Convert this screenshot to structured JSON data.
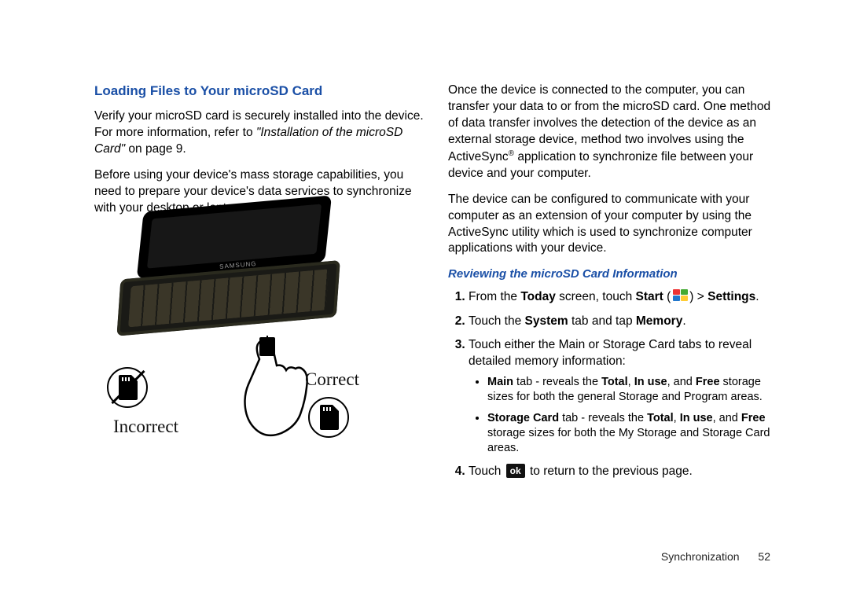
{
  "left": {
    "heading": "Loading Files to Your microSD Card",
    "para1_a": "Verify your microSD card is securely installed into the device. For more information, refer to ",
    "para1_ref": "\"Installation of the microSD Card\"",
    "para1_b": " on page 9.",
    "para2": "Before using your device's mass storage capabilities, you need to prepare your device's data services to synchronize with your desktop or laptop computer.",
    "illustration": {
      "brand": "SAMSUNG",
      "label_incorrect": "Incorrect",
      "label_correct": "Correct"
    }
  },
  "right": {
    "para1": "Once the device is connected to the computer, you can transfer your data to or from the microSD card. One method of data transfer involves the detection of the device as an external storage device, method two involves using the ActiveSync",
    "para1_sup": "®",
    "para1_b": " application to synchronize file between your device and your computer.",
    "para2": "The device can be configured to communicate with your computer as an extension of your computer by using the ActiveSync utility which is used to synchronize computer applications with your device.",
    "subhead": "Reviewing the microSD Card Information",
    "step1_a": "From the ",
    "step1_b": "Today",
    "step1_c": " screen, touch ",
    "step1_d": "Start",
    "step1_e": " (",
    "step1_f": ") > ",
    "step1_g": "Settings",
    "step1_h": ".",
    "step2_a": "Touch the ",
    "step2_b": "System",
    "step2_c": " tab and tap ",
    "step2_d": "Memory",
    "step2_e": ".",
    "step3": "Touch either the Main or Storage Card tabs to reveal detailed memory information:",
    "bullet1_a": "Main",
    "bullet1_b": " tab - reveals the ",
    "bullet1_c": "Total",
    "bullet1_d": ", ",
    "bullet1_e": "In use",
    "bullet1_f": ", and ",
    "bullet1_g": "Free",
    "bullet1_h": " storage sizes for both the general Storage and Program areas.",
    "bullet2_a": "Storage Card",
    "bullet2_b": " tab - reveals the ",
    "bullet2_c": "Total",
    "bullet2_d": ", ",
    "bullet2_e": "In use",
    "bullet2_f": ", and ",
    "bullet2_g": "Free",
    "bullet2_h": " storage sizes for both the My Storage and Storage Card areas.",
    "step4_a": "Touch ",
    "step4_ok": "ok",
    "step4_b": " to return to the previous page."
  },
  "footer": {
    "section": "Synchronization",
    "page": "52"
  }
}
